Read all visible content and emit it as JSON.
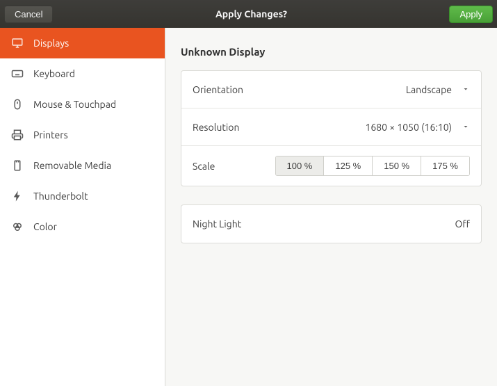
{
  "titlebar": {
    "cancel": "Cancel",
    "title": "Apply Changes?",
    "apply": "Apply"
  },
  "sidebar": {
    "items": [
      {
        "label": "Displays"
      },
      {
        "label": "Keyboard"
      },
      {
        "label": "Mouse & Touchpad"
      },
      {
        "label": "Printers"
      },
      {
        "label": "Removable Media"
      },
      {
        "label": "Thunderbolt"
      },
      {
        "label": "Color"
      }
    ]
  },
  "main": {
    "display_name": "Unknown Display",
    "orientation_label": "Orientation",
    "orientation_value": "Landscape",
    "resolution_label": "Resolution",
    "resolution_value": "1680 × 1050 (16:10)",
    "scale_label": "Scale",
    "scale_options": [
      "100 %",
      "125 %",
      "150 %",
      "175 %"
    ],
    "night_light_label": "Night Light",
    "night_light_value": "Off"
  }
}
